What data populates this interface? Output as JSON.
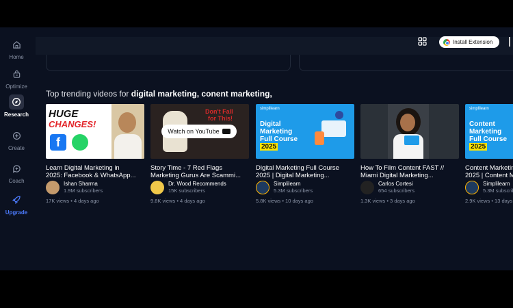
{
  "sidebar": {
    "items": [
      {
        "label": "Home",
        "icon": "home-icon"
      },
      {
        "label": "Optimize",
        "icon": "optimize-icon"
      },
      {
        "label": "Research",
        "icon": "compass-icon"
      },
      {
        "label": "Create",
        "icon": "plus-icon"
      },
      {
        "label": "Coach",
        "icon": "coach-icon"
      },
      {
        "label": "Upgrade",
        "icon": "rocket-icon"
      }
    ]
  },
  "header": {
    "extension_button": "Install Extension"
  },
  "trending": {
    "prefix": "Top trending videos for ",
    "keywords": "digital marketing, conent marketing,"
  },
  "videos": [
    {
      "title_line1": "Learn Digital Marketing in",
      "title_line2": "2025: Facebook & WhatsApp...",
      "channel": "Ishan Sharma",
      "subscribers": "1.9M subscribers",
      "meta": "17K views • 4 days ago",
      "thumb_text1": "HUGE",
      "thumb_text2": "CHANGES!"
    },
    {
      "title_line1": "Story Time - 7 Red Flags",
      "title_line2": "Marketing Gurus Are Scammi...",
      "channel": "Dr. Wood Recommends",
      "subscribers": "15K subscribers",
      "meta": "9.8K views • 4 days ago",
      "thumb_text1": "Don't Fall",
      "thumb_text2": "for This!",
      "overlay": "Watch on YouTube"
    },
    {
      "title_line1": "Digital Marketing Full Course",
      "title_line2": "2025 | Digital Marketing...",
      "channel": "Simplilearn",
      "subscribers": "5.3M subscribers",
      "meta": "5.8K views • 10 days ago",
      "brand": "simplilearn",
      "thumb_text1": "Digital",
      "thumb_text2": "Marketing",
      "thumb_text3": "Full Course",
      "thumb_year": "2025"
    },
    {
      "title_line1": "How To Film Content FAST //",
      "title_line2": "Miami Digital Marketing...",
      "channel": "Carlos Cortesi",
      "subscribers": "654 subscribers",
      "meta": "1.3K views • 3 days ago"
    },
    {
      "title_line1": "Content Marketing",
      "title_line2": "2025 | Content M...",
      "channel": "Simplilearn",
      "subscribers": "5.3M subscribers",
      "meta": "2.9K views • 13 days ago",
      "brand": "simplilearn",
      "thumb_text1": "Content",
      "thumb_text2": "Marketing",
      "thumb_text3": "Full Course",
      "thumb_year": "2025"
    }
  ],
  "colors": {
    "background": "#0b1120",
    "accent": "#4d7cff",
    "thumb_blue": "#1e9be9",
    "year_yellow": "#ffe600"
  }
}
